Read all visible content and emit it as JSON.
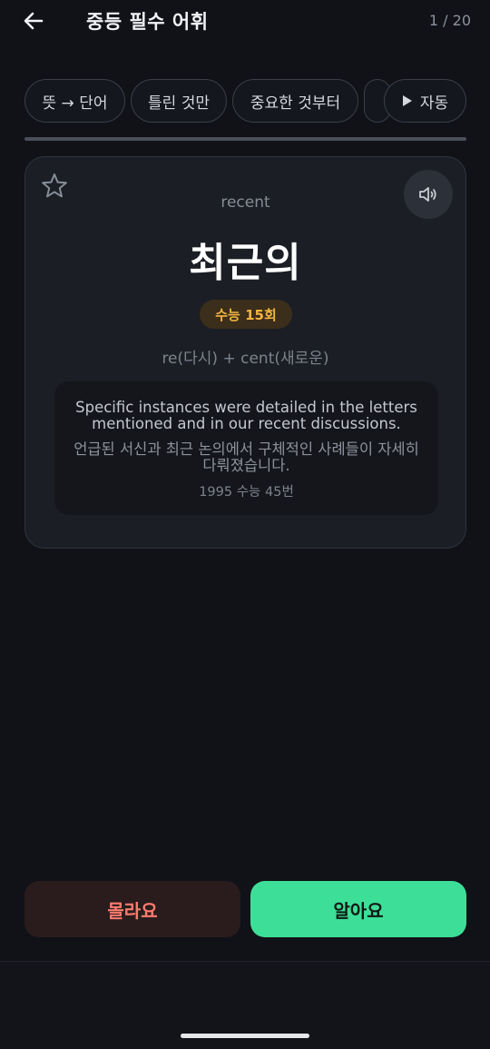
{
  "header": {
    "title": "중등 필수 어휘",
    "progress": "1 / 20"
  },
  "chips": [
    {
      "label": "뜻 → 단어"
    },
    {
      "label": "틀린 것만"
    },
    {
      "label": "중요한 것부터"
    },
    {
      "label": "자동"
    }
  ],
  "progress_fraction": 1.0,
  "card": {
    "word_en": "recent",
    "word_ko": "최근의",
    "frequency_badge": "수능 15회",
    "etymology": "re(다시) + cent(새로운)",
    "example_en": "Specific instances were detailed in the letters mentioned and in our recent discussions.",
    "example_ko": "언급된 서신과 최근 논의에서 구체적인 사례들이 자세히 다뤄졌습니다.",
    "example_source": "1995 수능 45번"
  },
  "actions": {
    "unknown_label": "몰라요",
    "known_label": "알아요"
  },
  "colors": {
    "background": "#101217",
    "known_button": "#3ddf98",
    "unknown_button_text": "#ff7b6e",
    "badge_text": "#f3b541"
  },
  "icons": [
    "back-arrow-icon",
    "star-icon",
    "speaker-icon",
    "play-icon"
  ]
}
